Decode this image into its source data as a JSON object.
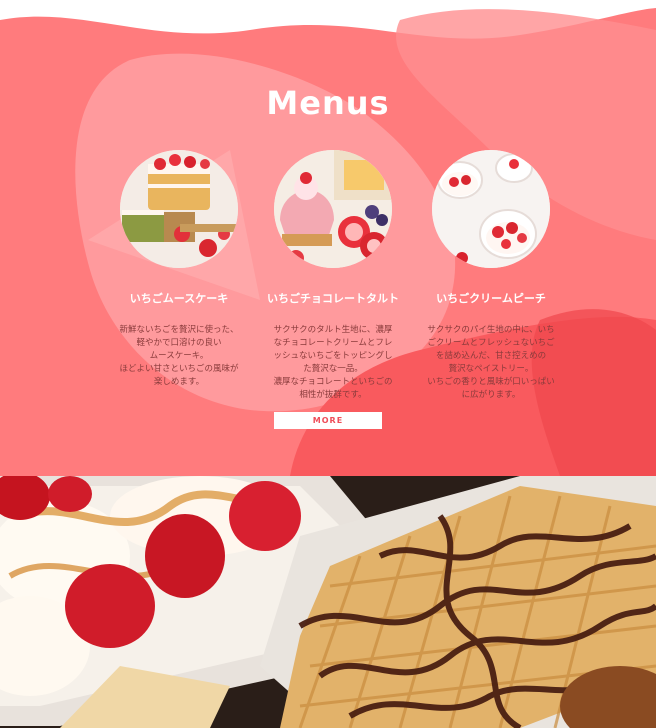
{
  "menus": {
    "title": "Menus",
    "items": [
      {
        "name": "いちごムースケーキ",
        "description": "新鮮ないちごを贅沢に使った、\n軽やかで口溶けの良い\nムースケーキ。\nほどよい甘さといちごの風味が\n楽しめます。",
        "image_subject": "strawberry mousse cake slices"
      },
      {
        "name": "いちごチョコレートタルト",
        "description": "サクサクのタルト生地に、濃厚\nなチョコレートクリームとフレ\nッシュないちごをトッピングし\nた贅沢な一品。\n濃厚なチョコレートといちごの\n相性が抜群です。",
        "image_subject": "strawberry chocolate tart"
      },
      {
        "name": "いちごクリームピーチ",
        "description": "サクサクのパイ生地の中に、いち\nごクリームとフレッシュないちご\nを詰め込んだ、甘さ控えめの\n贅沢なペイストリー。\nいちごの香りと風味が口いっぱい\nに広がります。",
        "image_subject": "strawberry cream cups"
      }
    ],
    "more_label": "MORE"
  },
  "hero": {
    "image_subject": "waffles with strawberries and chocolate sauce"
  },
  "colors": {
    "section_bg": "#ff7b7d",
    "blob_light": "#ffa0a2",
    "blob_dark": "#f95a5e",
    "accent_text": "#ef4e59",
    "description_text": "#8a3b3b"
  }
}
